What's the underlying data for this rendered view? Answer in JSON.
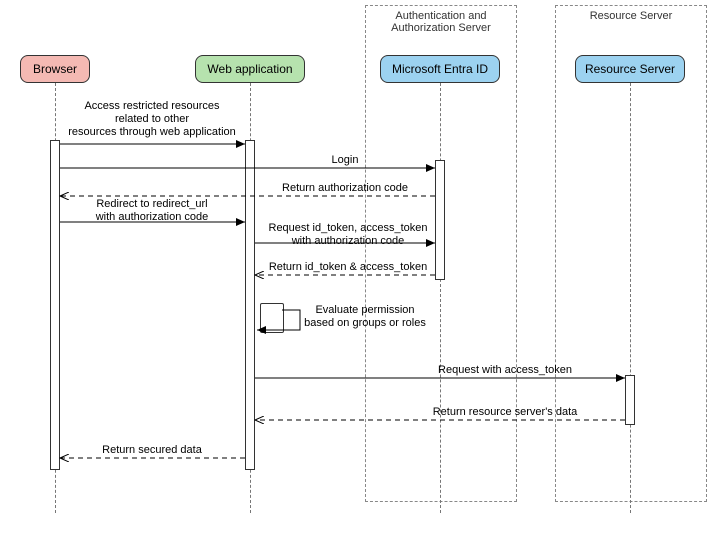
{
  "boundaries": {
    "auth": {
      "label": "Authentication and\nAuthorization Server"
    },
    "res": {
      "label": "Resource Server"
    }
  },
  "participants": {
    "browser": {
      "label": "Browser",
      "color": "#F4B9B3"
    },
    "webapp": {
      "label": "Web application",
      "color": "#B6E2AE"
    },
    "entra": {
      "label": "Microsoft Entra ID",
      "color": "#9CD2F0"
    },
    "resource": {
      "label": "Resource Server",
      "color": "#9CD2F0"
    }
  },
  "messages": {
    "m1": "Access restricted resources\nrelated to other\nresources through web application",
    "m2": "Login",
    "m3": "Return authorization code",
    "m4": "Redirect to redirect_url\nwith authorization code",
    "m5": "Request id_token, access_token\nwith authorization code",
    "m6": "Return id_token & access_token",
    "m7": "Evaluate permission\nbased on groups or roles",
    "m8": "Request with access_token",
    "m9": "Return resource server's data",
    "m10": "Return secured data"
  }
}
